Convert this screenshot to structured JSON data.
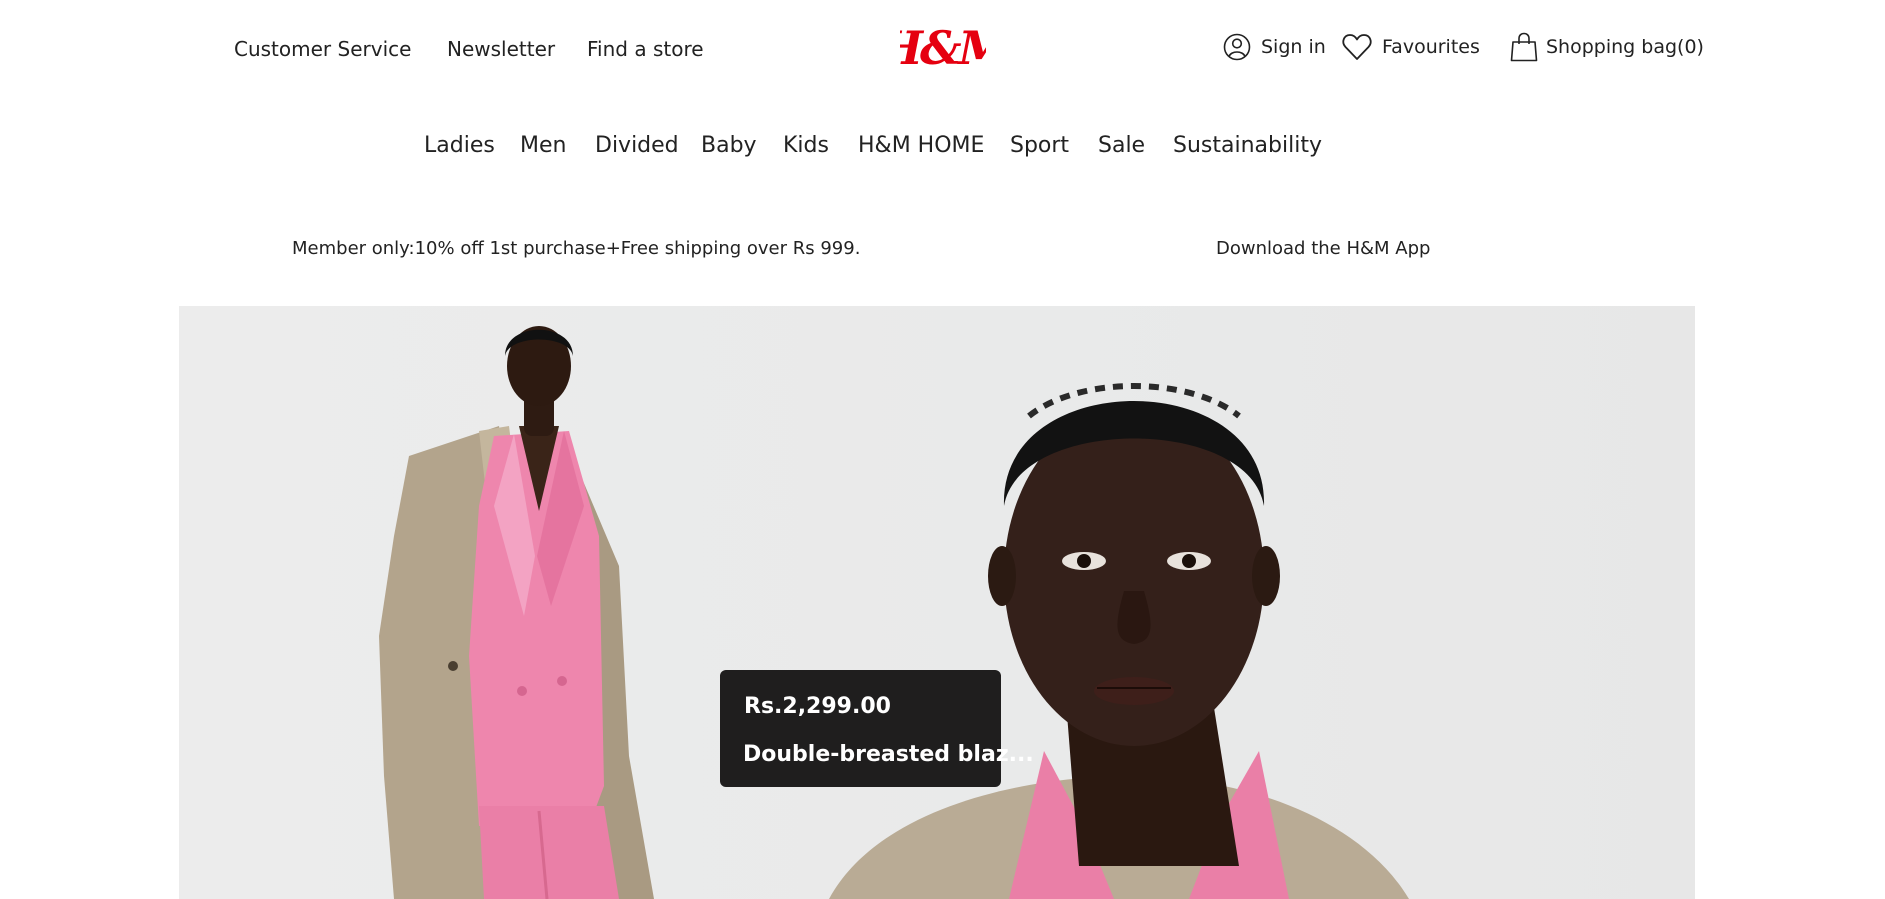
{
  "header": {
    "utility_links": [
      "Customer Service",
      "Newsletter",
      "Find a store"
    ],
    "brand": "H&M",
    "account": {
      "sign_in": "Sign in",
      "favourites": "Favourites",
      "shopping_bag": "Shopping bag(0)"
    },
    "icons": {
      "sign_in": "user-icon",
      "favourites": "heart-icon",
      "shopping_bag": "shopping-bag-icon"
    }
  },
  "nav": {
    "items": [
      "Ladies",
      "Men",
      "Divided",
      "Baby",
      "Kids",
      "H&M HOME",
      "Sport",
      "Sale",
      "Sustainability"
    ]
  },
  "promo": {
    "member": "Member only:10% off 1st purchase+Free shipping over Rs 999.",
    "app": "Download the H&M App"
  },
  "hero": {
    "product_tag": {
      "price": "Rs.2,299.00",
      "name": "Double-breasted blaz..."
    }
  },
  "colors": {
    "brand_red": "#e50010",
    "text": "#222222",
    "tooltip_bg": "#1f1e1e",
    "hero_bg": "#eaeaea",
    "blazer_pink": "#ee86ad",
    "coat_beige": "#b3a48c"
  }
}
